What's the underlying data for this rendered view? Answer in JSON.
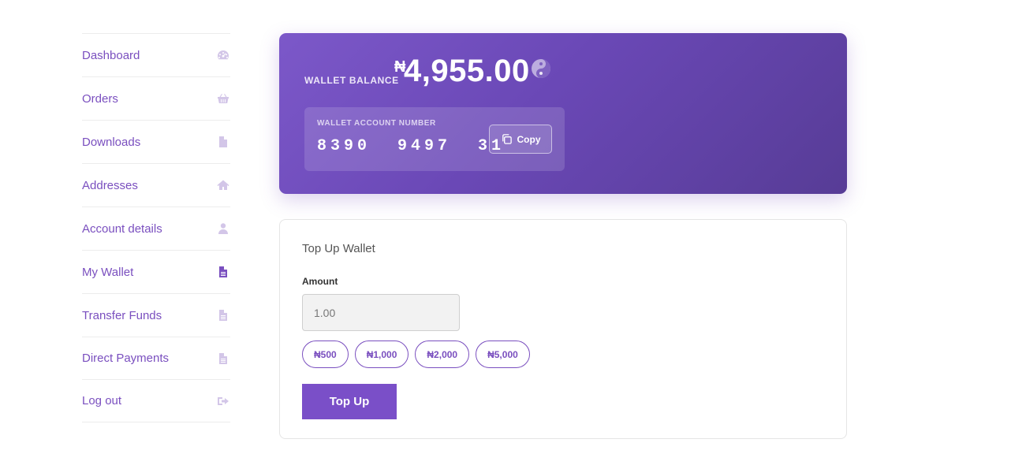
{
  "sidebar": {
    "items": [
      {
        "label": "Dashboard",
        "icon": "dashboard-icon"
      },
      {
        "label": "Orders",
        "icon": "basket-icon"
      },
      {
        "label": "Downloads",
        "icon": "file-icon"
      },
      {
        "label": "Addresses",
        "icon": "home-icon"
      },
      {
        "label": "Account details",
        "icon": "user-icon"
      },
      {
        "label": "My Wallet",
        "icon": "file-text-icon",
        "active": true
      },
      {
        "label": "Transfer Funds",
        "icon": "file-text-icon"
      },
      {
        "label": "Direct Payments",
        "icon": "file-text-icon"
      },
      {
        "label": "Log out",
        "icon": "sign-out-icon"
      }
    ]
  },
  "wallet": {
    "balance_label": "WALLET BALANCE",
    "currency_symbol": "₦",
    "balance": "4,955.00",
    "account_label": "WALLET ACCOUNT NUMBER",
    "account_number": "8390  9497  31",
    "copy_label": "Copy"
  },
  "topup": {
    "title": "Top Up Wallet",
    "amount_label": "Amount",
    "amount_value": "1.00",
    "presets": [
      "₦500",
      "₦1,000",
      "₦2,000",
      "₦5,000"
    ],
    "button_label": "Top Up"
  },
  "colors": {
    "accent": "#7a4fbf",
    "card_gradient_start": "#7c58c9",
    "card_gradient_end": "#573c96",
    "muted_icon": "#d3c6e8"
  }
}
